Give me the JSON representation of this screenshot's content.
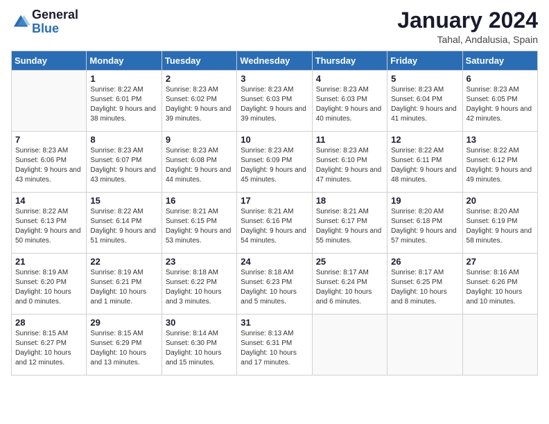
{
  "logo": {
    "general": "General",
    "blue": "Blue"
  },
  "header": {
    "month": "January 2024",
    "location": "Tahal, Andalusia, Spain"
  },
  "days_of_week": [
    "Sunday",
    "Monday",
    "Tuesday",
    "Wednesday",
    "Thursday",
    "Friday",
    "Saturday"
  ],
  "weeks": [
    [
      {
        "day": "",
        "sunrise": "",
        "sunset": "",
        "daylight": ""
      },
      {
        "day": "1",
        "sunrise": "Sunrise: 8:22 AM",
        "sunset": "Sunset: 6:01 PM",
        "daylight": "Daylight: 9 hours and 38 minutes."
      },
      {
        "day": "2",
        "sunrise": "Sunrise: 8:23 AM",
        "sunset": "Sunset: 6:02 PM",
        "daylight": "Daylight: 9 hours and 39 minutes."
      },
      {
        "day": "3",
        "sunrise": "Sunrise: 8:23 AM",
        "sunset": "Sunset: 6:03 PM",
        "daylight": "Daylight: 9 hours and 39 minutes."
      },
      {
        "day": "4",
        "sunrise": "Sunrise: 8:23 AM",
        "sunset": "Sunset: 6:03 PM",
        "daylight": "Daylight: 9 hours and 40 minutes."
      },
      {
        "day": "5",
        "sunrise": "Sunrise: 8:23 AM",
        "sunset": "Sunset: 6:04 PM",
        "daylight": "Daylight: 9 hours and 41 minutes."
      },
      {
        "day": "6",
        "sunrise": "Sunrise: 8:23 AM",
        "sunset": "Sunset: 6:05 PM",
        "daylight": "Daylight: 9 hours and 42 minutes."
      }
    ],
    [
      {
        "day": "7",
        "sunrise": "Sunrise: 8:23 AM",
        "sunset": "Sunset: 6:06 PM",
        "daylight": "Daylight: 9 hours and 43 minutes."
      },
      {
        "day": "8",
        "sunrise": "Sunrise: 8:23 AM",
        "sunset": "Sunset: 6:07 PM",
        "daylight": "Daylight: 9 hours and 43 minutes."
      },
      {
        "day": "9",
        "sunrise": "Sunrise: 8:23 AM",
        "sunset": "Sunset: 6:08 PM",
        "daylight": "Daylight: 9 hours and 44 minutes."
      },
      {
        "day": "10",
        "sunrise": "Sunrise: 8:23 AM",
        "sunset": "Sunset: 6:09 PM",
        "daylight": "Daylight: 9 hours and 45 minutes."
      },
      {
        "day": "11",
        "sunrise": "Sunrise: 8:23 AM",
        "sunset": "Sunset: 6:10 PM",
        "daylight": "Daylight: 9 hours and 47 minutes."
      },
      {
        "day": "12",
        "sunrise": "Sunrise: 8:22 AM",
        "sunset": "Sunset: 6:11 PM",
        "daylight": "Daylight: 9 hours and 48 minutes."
      },
      {
        "day": "13",
        "sunrise": "Sunrise: 8:22 AM",
        "sunset": "Sunset: 6:12 PM",
        "daylight": "Daylight: 9 hours and 49 minutes."
      }
    ],
    [
      {
        "day": "14",
        "sunrise": "Sunrise: 8:22 AM",
        "sunset": "Sunset: 6:13 PM",
        "daylight": "Daylight: 9 hours and 50 minutes."
      },
      {
        "day": "15",
        "sunrise": "Sunrise: 8:22 AM",
        "sunset": "Sunset: 6:14 PM",
        "daylight": "Daylight: 9 hours and 51 minutes."
      },
      {
        "day": "16",
        "sunrise": "Sunrise: 8:21 AM",
        "sunset": "Sunset: 6:15 PM",
        "daylight": "Daylight: 9 hours and 53 minutes."
      },
      {
        "day": "17",
        "sunrise": "Sunrise: 8:21 AM",
        "sunset": "Sunset: 6:16 PM",
        "daylight": "Daylight: 9 hours and 54 minutes."
      },
      {
        "day": "18",
        "sunrise": "Sunrise: 8:21 AM",
        "sunset": "Sunset: 6:17 PM",
        "daylight": "Daylight: 9 hours and 55 minutes."
      },
      {
        "day": "19",
        "sunrise": "Sunrise: 8:20 AM",
        "sunset": "Sunset: 6:18 PM",
        "daylight": "Daylight: 9 hours and 57 minutes."
      },
      {
        "day": "20",
        "sunrise": "Sunrise: 8:20 AM",
        "sunset": "Sunset: 6:19 PM",
        "daylight": "Daylight: 9 hours and 58 minutes."
      }
    ],
    [
      {
        "day": "21",
        "sunrise": "Sunrise: 8:19 AM",
        "sunset": "Sunset: 6:20 PM",
        "daylight": "Daylight: 10 hours and 0 minutes."
      },
      {
        "day": "22",
        "sunrise": "Sunrise: 8:19 AM",
        "sunset": "Sunset: 6:21 PM",
        "daylight": "Daylight: 10 hours and 1 minute."
      },
      {
        "day": "23",
        "sunrise": "Sunrise: 8:18 AM",
        "sunset": "Sunset: 6:22 PM",
        "daylight": "Daylight: 10 hours and 3 minutes."
      },
      {
        "day": "24",
        "sunrise": "Sunrise: 8:18 AM",
        "sunset": "Sunset: 6:23 PM",
        "daylight": "Daylight: 10 hours and 5 minutes."
      },
      {
        "day": "25",
        "sunrise": "Sunrise: 8:17 AM",
        "sunset": "Sunset: 6:24 PM",
        "daylight": "Daylight: 10 hours and 6 minutes."
      },
      {
        "day": "26",
        "sunrise": "Sunrise: 8:17 AM",
        "sunset": "Sunset: 6:25 PM",
        "daylight": "Daylight: 10 hours and 8 minutes."
      },
      {
        "day": "27",
        "sunrise": "Sunrise: 8:16 AM",
        "sunset": "Sunset: 6:26 PM",
        "daylight": "Daylight: 10 hours and 10 minutes."
      }
    ],
    [
      {
        "day": "28",
        "sunrise": "Sunrise: 8:15 AM",
        "sunset": "Sunset: 6:27 PM",
        "daylight": "Daylight: 10 hours and 12 minutes."
      },
      {
        "day": "29",
        "sunrise": "Sunrise: 8:15 AM",
        "sunset": "Sunset: 6:29 PM",
        "daylight": "Daylight: 10 hours and 13 minutes."
      },
      {
        "day": "30",
        "sunrise": "Sunrise: 8:14 AM",
        "sunset": "Sunset: 6:30 PM",
        "daylight": "Daylight: 10 hours and 15 minutes."
      },
      {
        "day": "31",
        "sunrise": "Sunrise: 8:13 AM",
        "sunset": "Sunset: 6:31 PM",
        "daylight": "Daylight: 10 hours and 17 minutes."
      },
      {
        "day": "",
        "sunrise": "",
        "sunset": "",
        "daylight": ""
      },
      {
        "day": "",
        "sunrise": "",
        "sunset": "",
        "daylight": ""
      },
      {
        "day": "",
        "sunrise": "",
        "sunset": "",
        "daylight": ""
      }
    ]
  ]
}
